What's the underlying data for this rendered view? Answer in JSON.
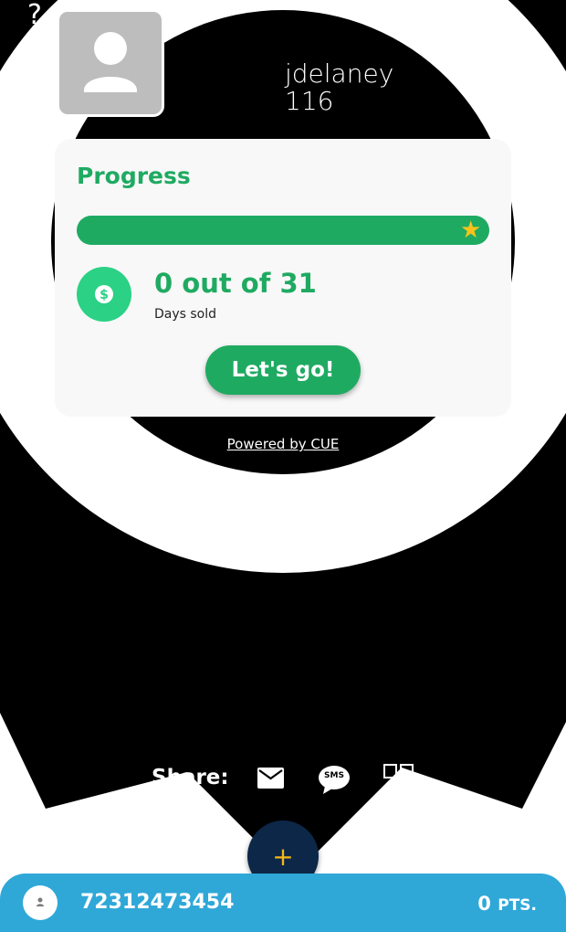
{
  "profile": {
    "username": "jdelaney",
    "number": "116"
  },
  "progress": {
    "title": "Progress",
    "fraction": 0,
    "count_text": "0 out of 31",
    "count_label": "Days sold",
    "button_label": "Let's go!"
  },
  "powered_by": "Powered by CUE",
  "share": {
    "label": "Share:",
    "sms_label": "SMS"
  },
  "fab_label": "+",
  "footer": {
    "id": "72312473454",
    "points_value": "0",
    "points_suffix": "PTS."
  },
  "colors": {
    "accent_green": "#1faa62",
    "coin_green": "#2bd185",
    "footer_blue": "#2fa8d8",
    "fab_navy": "#0d2748",
    "star_gold": "#f9c21b"
  }
}
